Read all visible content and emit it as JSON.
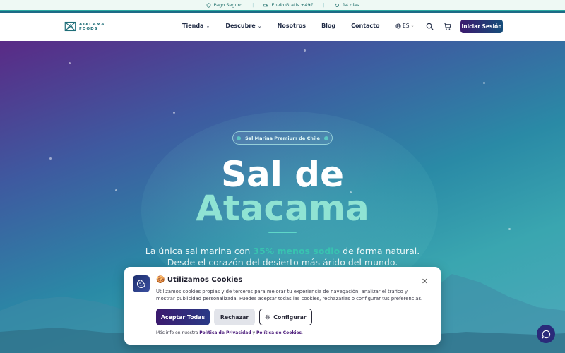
{
  "promo": {
    "items": [
      {
        "icon": "shield-icon",
        "text": "Pago Seguro"
      },
      {
        "icon": "truck-icon",
        "text": "Envío Gratis +49€"
      },
      {
        "icon": "return-icon",
        "text": "14 días"
      }
    ]
  },
  "header": {
    "logo_line1": "ATACAMA",
    "logo_line2": "FOODS",
    "nav": [
      {
        "label": "Tienda",
        "dropdown": true
      },
      {
        "label": "Descubre",
        "dropdown": true
      },
      {
        "label": "Nosotros",
        "dropdown": false
      },
      {
        "label": "Blog",
        "dropdown": false
      },
      {
        "label": "Contacto",
        "dropdown": false
      }
    ],
    "language": "ES",
    "login_label": "Iniciar Sesión"
  },
  "hero": {
    "badge": "Sal Marina Premium de Chile",
    "title_line1": "Sal de",
    "title_line2": "Atacama",
    "subtitle_pre": "La única sal marina con ",
    "subtitle_highlight": "35% menos sodio",
    "subtitle_post": " de forma natural.",
    "subtitle_line2": "Desde el corazón del desierto más árido del mundo."
  },
  "cookie": {
    "title": "🍪 Utilizamos Cookies",
    "text": "Utilizamos cookies propias y de terceros para mejorar tu experiencia de navegación, analizar el tráfico y mostrar publicidad personalizada. Puedes aceptar todas las cookies, rechazarlas o configurar tus preferencias.",
    "accept_label": "Aceptar Todas",
    "reject_label": "Rechazar",
    "config_label": "Configurar",
    "footer_pre": "Más info en nuestra ",
    "privacy_link": "Política de Privacidad",
    "footer_and": " y ",
    "cookies_link": "Política de Cookies",
    "footer_end": "."
  },
  "colors": {
    "brand_primary": "#3b1a6e",
    "accent_teal": "#38c3b0",
    "hero_title_accent": "#8fe3d3"
  }
}
